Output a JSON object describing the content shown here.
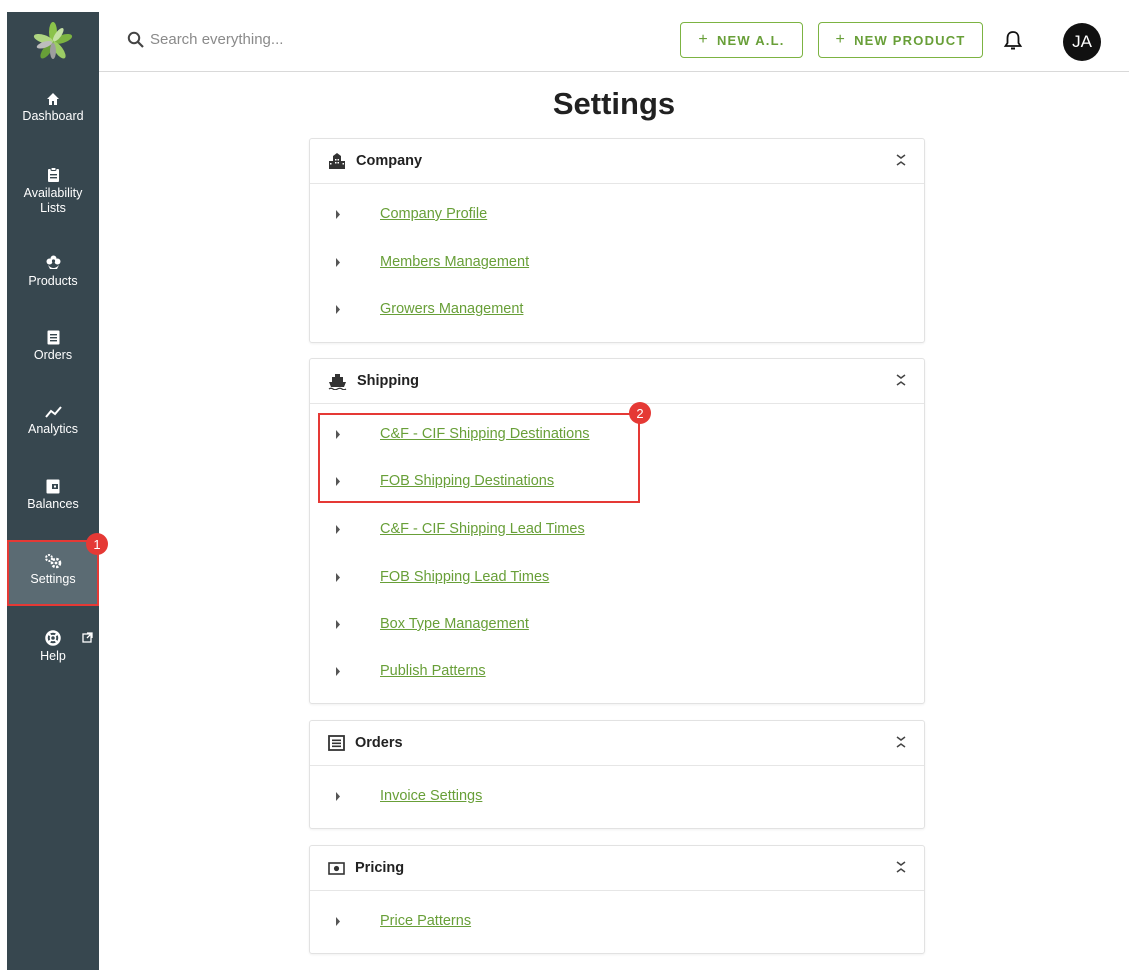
{
  "search": {
    "placeholder": "Search everything..."
  },
  "header": {
    "new_al": "NEW A.L.",
    "new_product": "NEW PRODUCT",
    "plus": "+",
    "avatar_initials": "JA"
  },
  "sidebar": {
    "items": [
      {
        "label": "Dashboard",
        "icon": "home-icon"
      },
      {
        "label": "Availability\nLists",
        "icon": "clipboard-icon"
      },
      {
        "label": "Products",
        "icon": "flower-icon"
      },
      {
        "label": "Orders",
        "icon": "list-icon"
      },
      {
        "label": "Analytics",
        "icon": "trend-icon"
      },
      {
        "label": "Balances",
        "icon": "wallet-icon"
      },
      {
        "label": "Settings",
        "icon": "gears-icon"
      },
      {
        "label": "Help",
        "icon": "lifebuoy-icon"
      }
    ],
    "active": "Settings"
  },
  "page": {
    "title": "Settings"
  },
  "sections": {
    "company": {
      "title": "Company",
      "items": [
        "Company Profile",
        "Members Management",
        "Growers Management"
      ]
    },
    "shipping": {
      "title": "Shipping",
      "items": [
        "C&F - CIF Shipping Destinations",
        "FOB Shipping Destinations",
        "C&F - CIF Shipping Lead Times",
        "FOB Shipping Lead Times",
        "Box Type Management",
        "Publish Patterns"
      ]
    },
    "orders": {
      "title": "Orders",
      "items": [
        "Invoice Settings"
      ]
    },
    "pricing": {
      "title": "Pricing",
      "items": [
        "Price Patterns"
      ]
    }
  },
  "annotations": {
    "badge1": "1",
    "badge2": "2"
  },
  "colors": {
    "sidebar": "#37474f",
    "accent": "#689f38",
    "highlight": "#e53935"
  }
}
